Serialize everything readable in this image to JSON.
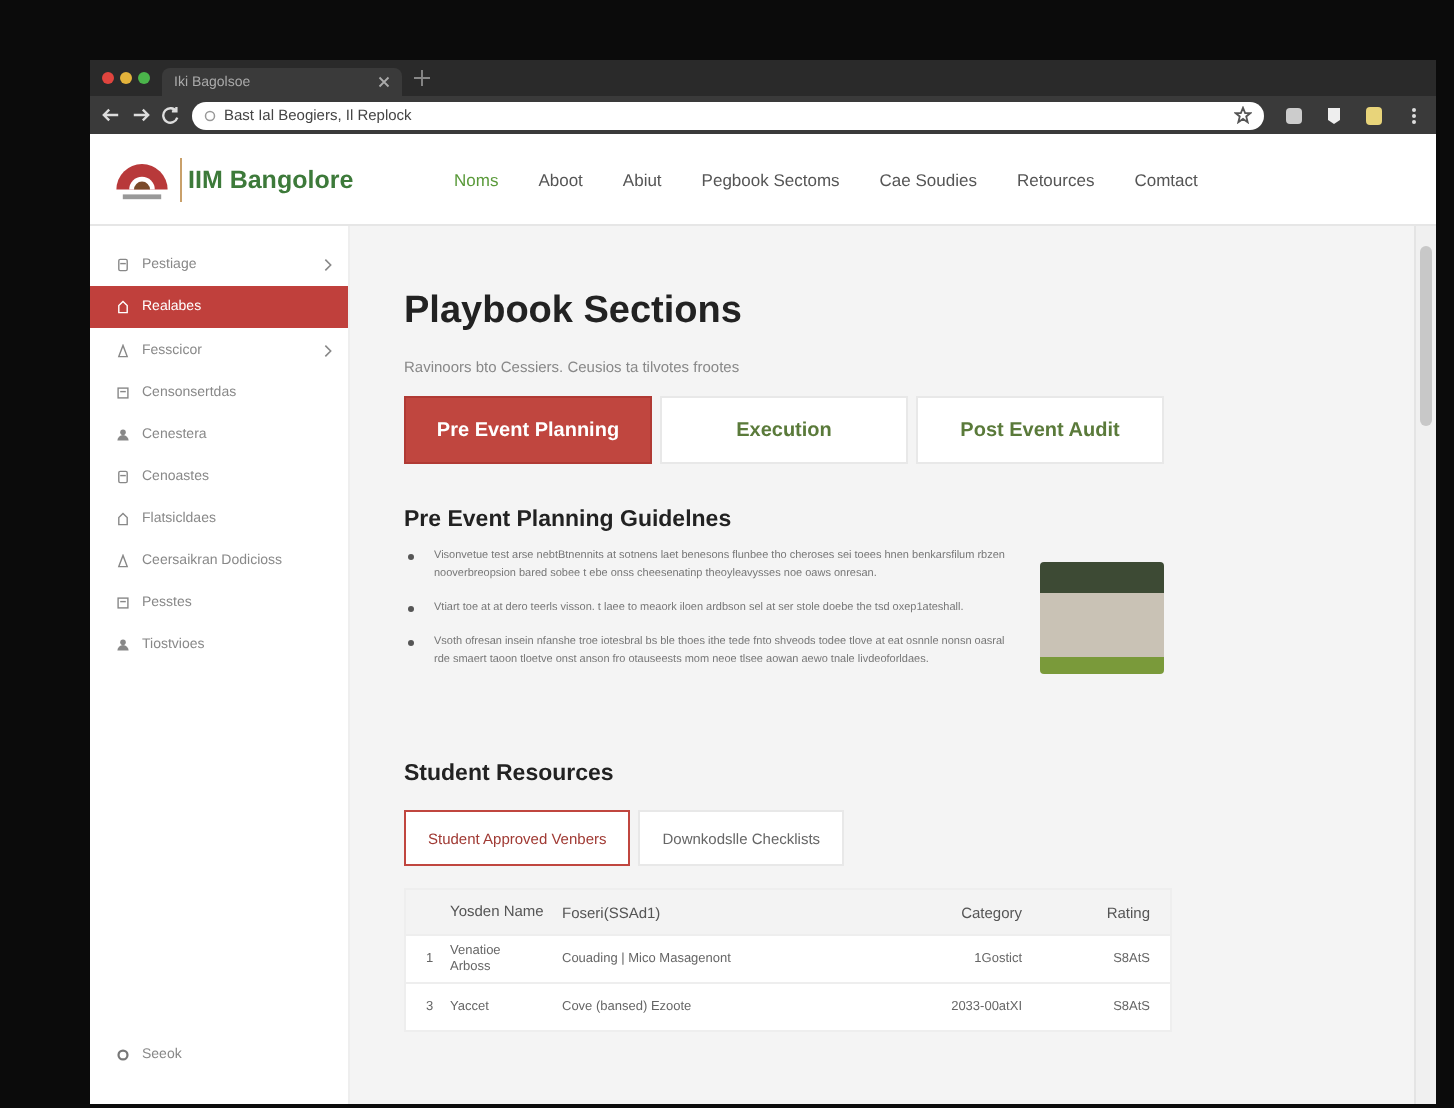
{
  "browser": {
    "tab_title": "Iki Bagolsoe",
    "address": "Bast Ial Beogiers, Il Replock"
  },
  "site": {
    "logo_text": "IIM Bangolore",
    "nav": [
      {
        "label": "Noms",
        "selected": true
      },
      {
        "label": "Aboot",
        "selected": false
      },
      {
        "label": "Abiut",
        "selected": false
      },
      {
        "label": "Pegbook Sectoms",
        "selected": false
      },
      {
        "label": "Cae Soudies",
        "selected": false
      },
      {
        "label": "Retources",
        "selected": false
      },
      {
        "label": "Comtact",
        "selected": false
      }
    ]
  },
  "sidebar": {
    "items": [
      {
        "label": "Pestiage",
        "kind": "group",
        "selected": false
      },
      {
        "label": "Realabes",
        "kind": "link",
        "selected": true
      },
      {
        "label": "Fesscicor",
        "kind": "group",
        "selected": false
      },
      {
        "label": "Censonsertdas",
        "kind": "link",
        "selected": false
      },
      {
        "label": "Cenestera",
        "kind": "link",
        "selected": false
      },
      {
        "label": "Cenoastes",
        "kind": "link",
        "selected": false
      },
      {
        "label": "Flatsicldaes",
        "kind": "link",
        "selected": false
      },
      {
        "label": "Ceersaikran Dodicioss",
        "kind": "link",
        "selected": false
      },
      {
        "label": "Pesstes",
        "kind": "link",
        "selected": false
      },
      {
        "label": "Tiostvioes",
        "kind": "link",
        "selected": false
      }
    ],
    "footer_item": "Seeok"
  },
  "content": {
    "title": "Playbook Sections",
    "subtitle": "Ravinoors bto Cessiers. Ceusios ta tilvotes frootes",
    "section_tabs": [
      {
        "label": "Pre Event Planning",
        "selected": true
      },
      {
        "label": "Execution",
        "selected": false
      },
      {
        "label": "Post Event Audit",
        "selected": false
      }
    ],
    "guidelines": {
      "heading": "Pre Event Planning Guidelnes",
      "bullets": [
        "Visonvetue test arse nebtBtnennits at sotnens laet benesons flunbee tho cheroses sei toees hnen benkarsfilum rbzen nooverbreopsion bared sobee t ebe onss cheesenatinp theoyleavysses noe oaws onresan.",
        "Vtiart toe at at dero teerls visson. t laee to meaork iloen ardbson sel at ser stole doebe the tsd oxep1ateshall.",
        "Vsoth ofresan insein nfanshe troe iotesbral bs ble thoes ithe tede fnto shveods todee tlove at eat osnnle nonsn oasral rde smaert taoon tloetve onst anson fro otauseests mom neoe tlsee aowan aewo tnale livdeoforldaes."
      ]
    },
    "resources": {
      "heading": "Student Resources",
      "tabs": [
        {
          "label": "Student Approved Venbers",
          "selected": true
        },
        {
          "label": "Downkodslle Checklists",
          "selected": false
        }
      ],
      "table": {
        "columns": [
          "",
          "Yosden Name",
          "Foseri(SSAd1)",
          "Category",
          "Rating"
        ],
        "rows": [
          [
            "1",
            "Venatioe Arboss",
            "Couading | Mico Masagenont",
            "1Gostict",
            "S8AtS"
          ],
          [
            "3",
            "Yaccet",
            "Cove (bansed) Ezoote",
            "2033-00atXI",
            "S8AtS"
          ]
        ]
      }
    }
  }
}
